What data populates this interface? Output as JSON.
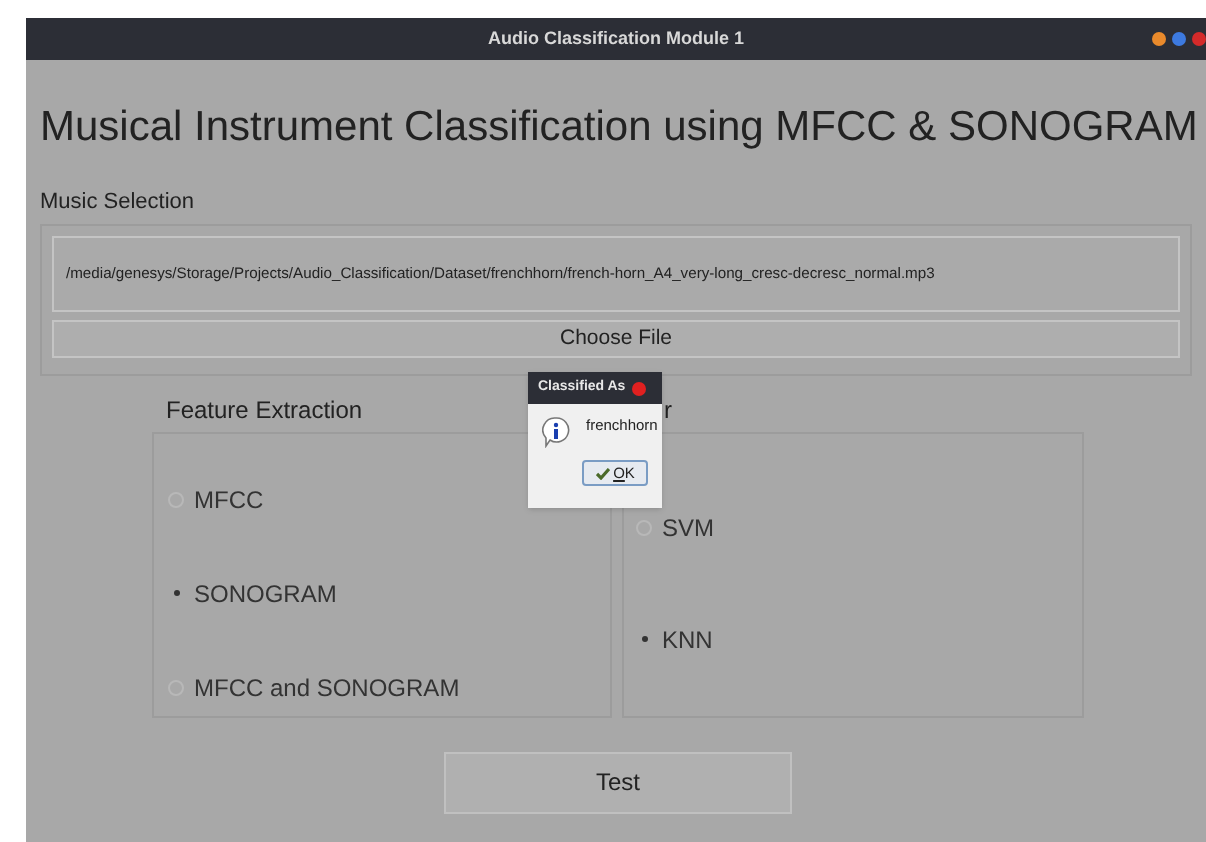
{
  "window": {
    "title": "Audio Classification Module 1"
  },
  "heading": "Musical Instrument Classification using MFCC & SONOGRAM",
  "music_selection": {
    "label": "Music Selection",
    "path": "/media/genesys/Storage/Projects/Audio_Classification/Dataset/frenchhorn/french-horn_A4_very-long_cresc-decresc_normal.mp3",
    "button": "Choose File"
  },
  "feature_extraction": {
    "title": "Feature Extraction",
    "options": [
      {
        "label": "MFCC",
        "selected": false
      },
      {
        "label": "SONOGRAM",
        "selected": true
      },
      {
        "label": "MFCC and SONOGRAM",
        "selected": false
      }
    ]
  },
  "classifier": {
    "title_visible": "r",
    "options": [
      {
        "label": "SVM",
        "selected": false
      },
      {
        "label": "KNN",
        "selected": true
      }
    ]
  },
  "test_button": "Test",
  "dialog": {
    "title": "Classified As",
    "message": "frenchhorn",
    "button": "OK"
  }
}
